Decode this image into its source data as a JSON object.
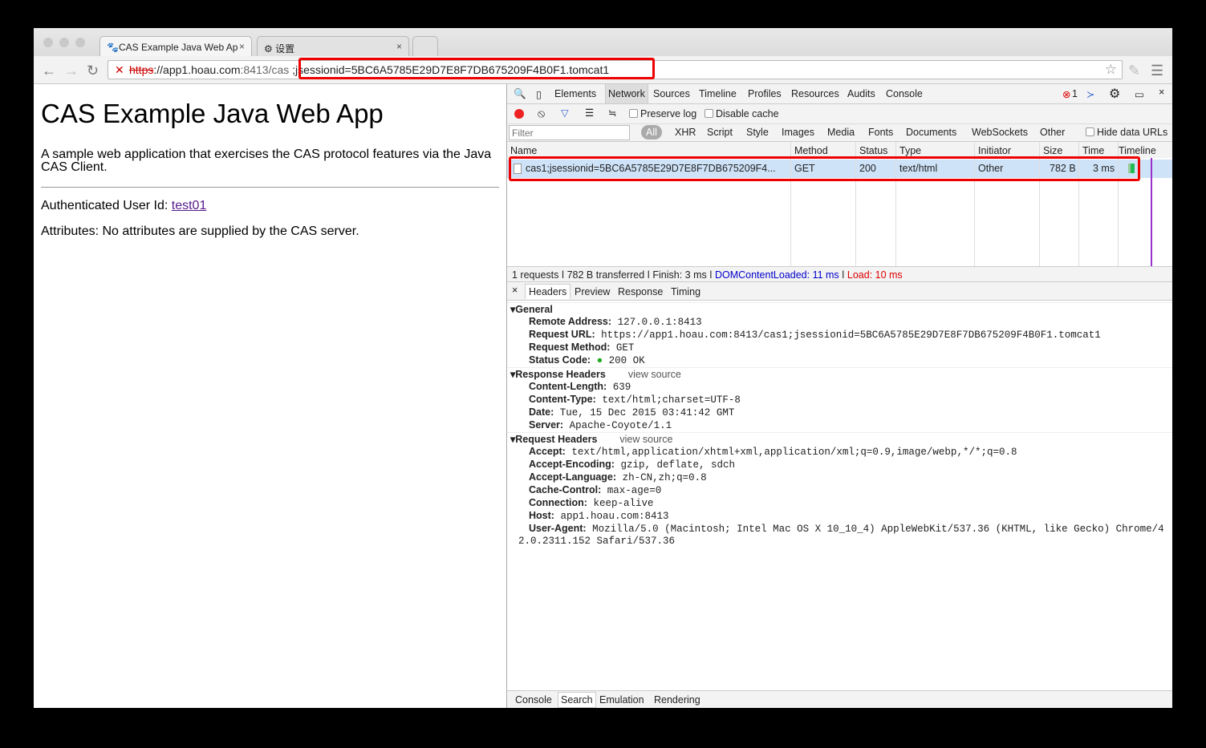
{
  "browser": {
    "tabs": [
      {
        "title": "CAS Example Java Web Ap"
      },
      {
        "title": "设置"
      }
    ],
    "url": {
      "scheme": "https",
      "host": "://app1.hoau.com",
      "port": ":8413/cas",
      "highlighted": ";jsessionid=5BC6A5785E29D7E8F7DB675209F4B0F1.tomcat1"
    }
  },
  "page": {
    "title": "CAS Example Java Web App",
    "description": "A sample web application that exercises the CAS protocol features via the Java CAS Client.",
    "auth_label": "Authenticated User Id: ",
    "user": "test01",
    "attributes": "Attributes: No attributes are supplied by the CAS server."
  },
  "devtools": {
    "panels": [
      "Elements",
      "Network",
      "Sources",
      "Timeline",
      "Profiles",
      "Resources",
      "Audits",
      "Console"
    ],
    "active_panel": "Network",
    "error_count": "1",
    "preserve_log": "Preserve log",
    "disable_cache": "Disable cache",
    "filter_placeholder": "Filter",
    "types": [
      "All",
      "XHR",
      "Script",
      "Style",
      "Images",
      "Media",
      "Fonts",
      "Documents",
      "WebSockets",
      "Other"
    ],
    "hide_data_urls": "Hide data URLs",
    "columns": [
      "Name",
      "Method",
      "Status",
      "Type",
      "Initiator",
      "Size",
      "Time",
      "Timeline"
    ],
    "request": {
      "name": "cas1;jsessionid=5BC6A5785E29D7E8F7DB675209F4...",
      "method": "GET",
      "status": "200",
      "type": "text/html",
      "initiator": "Other",
      "size": "782 B",
      "time": "3 ms"
    },
    "summary": {
      "requests": "1 requests",
      "transferred": "782 B transferred",
      "finish": "Finish: 3 ms",
      "dcl": "DOMContentLoaded: 11 ms",
      "load": "Load: 10 ms"
    },
    "detail_tabs": [
      "Headers",
      "Preview",
      "Response",
      "Timing"
    ],
    "general": {
      "title": "General",
      "items": [
        [
          "Remote Address:",
          "127.0.0.1:8413"
        ],
        [
          "Request URL:",
          "https://app1.hoau.com:8413/cas1;jsessionid=5BC6A5785E29D7E8F7DB675209F4B0F1.tomcat1"
        ],
        [
          "Request Method:",
          "GET"
        ],
        [
          "Status Code:",
          "200 OK"
        ]
      ]
    },
    "response_headers": {
      "title": "Response Headers",
      "view_source": "view source",
      "items": [
        [
          "Content-Length:",
          "639"
        ],
        [
          "Content-Type:",
          "text/html;charset=UTF-8"
        ],
        [
          "Date:",
          "Tue, 15 Dec 2015 03:41:42 GMT"
        ],
        [
          "Server:",
          "Apache-Coyote/1.1"
        ]
      ]
    },
    "request_headers": {
      "title": "Request Headers",
      "view_source": "view source",
      "items": [
        [
          "Accept:",
          "text/html,application/xhtml+xml,application/xml;q=0.9,image/webp,*/*;q=0.8"
        ],
        [
          "Accept-Encoding:",
          "gzip, deflate, sdch"
        ],
        [
          "Accept-Language:",
          "zh-CN,zh;q=0.8"
        ],
        [
          "Cache-Control:",
          "max-age=0"
        ],
        [
          "Connection:",
          "keep-alive"
        ],
        [
          "Host:",
          "app1.hoau.com:8413"
        ],
        [
          "User-Agent:",
          "Mozilla/5.0 (Macintosh; Intel Mac OS X 10_10_4) AppleWebKit/537.36 (KHTML, like Gecko) Chrome/4"
        ]
      ],
      "wrap": "2.0.2311.152 Safari/537.36"
    },
    "drawer_tabs": [
      "Console",
      "Search",
      "Emulation",
      "Rendering"
    ]
  }
}
